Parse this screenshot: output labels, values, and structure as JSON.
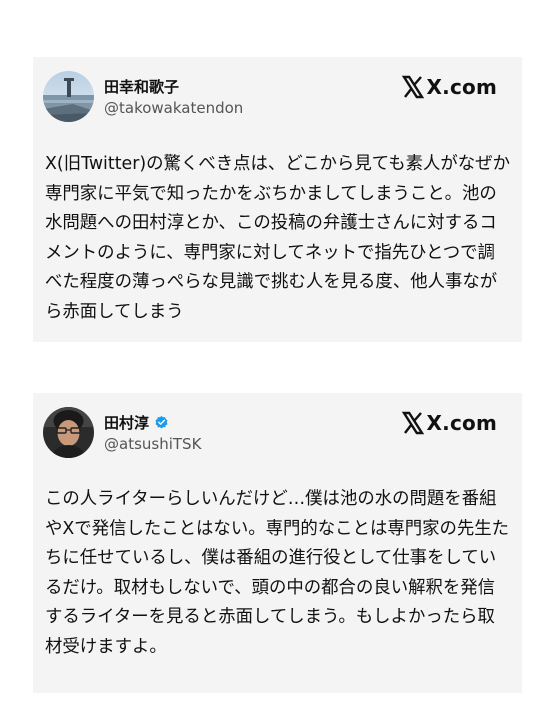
{
  "posts": [
    {
      "author": {
        "display_name": "田幸和歌子",
        "handle": "@takowakatendon",
        "verified": false,
        "avatar_icon": "landscape-avatar"
      },
      "brand": "X.com",
      "brand_icon": "x-logo-icon",
      "text": "X(旧Twitter)の驚くべき点は、どこから見ても素人がなぜか専門家に平気で知ったかをぶちかましてしまうこと。池の水問題への田村淳とか、この投稿の弁護士さんに対するコメントのように、専門家に対してネットで指先ひとつで調べた程度の薄っぺらな見識で挑む人を見る度、他人事ながら赤面してしまう"
    },
    {
      "author": {
        "display_name": "田村淳",
        "handle": "@atsushiTSK",
        "verified": true,
        "avatar_icon": "portrait-avatar"
      },
      "brand": "X.com",
      "brand_icon": "x-logo-icon",
      "text": "この人ライターらしいんだけど…僕は池の水の問題を番組やXで発信したことはない。専門的なことは専門家の先生たちに任せているし、僕は番組の進行役として仕事をしているだけ。取材もしないで、頭の中の都合の良い解釈を発信するライターを見ると赤面してしまう。もしよかったら取材受けますよ。"
    }
  ],
  "colors": {
    "card_background": "#f4f4f4",
    "text": "#111111",
    "handle": "#555555",
    "verified_badge": "#1d9bf0"
  }
}
